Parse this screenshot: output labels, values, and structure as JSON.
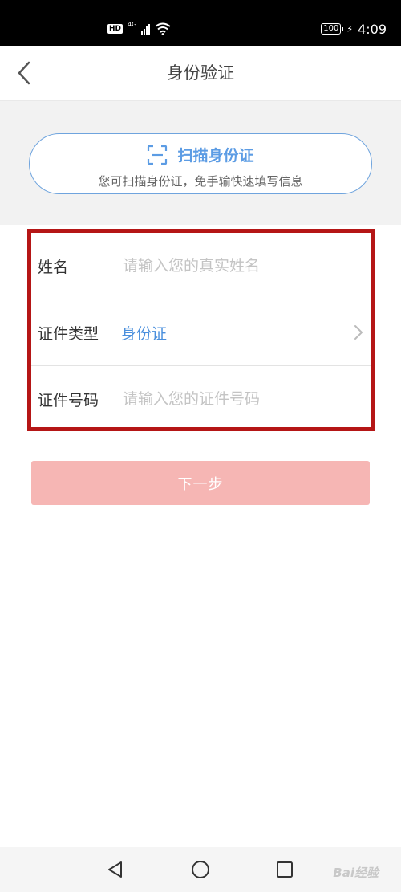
{
  "status_bar": {
    "hd": "HD",
    "network": "4G",
    "battery": "100",
    "time": "4:09"
  },
  "nav": {
    "title": "身份验证"
  },
  "scan": {
    "title": "扫描身份证",
    "subtitle": "您可扫描身份证，免手输快速填写信息"
  },
  "form": {
    "name_label": "姓名",
    "name_placeholder": "请输入您的真实姓名",
    "type_label": "证件类型",
    "type_value": "身份证",
    "id_label": "证件号码",
    "id_placeholder": "请输入您的证件号码"
  },
  "next_button": "下一步",
  "watermark": "Bai经验",
  "colors": {
    "accent_blue": "#5c9ce4",
    "highlight_red": "#b51616",
    "button_pink": "#f6b6b4"
  }
}
